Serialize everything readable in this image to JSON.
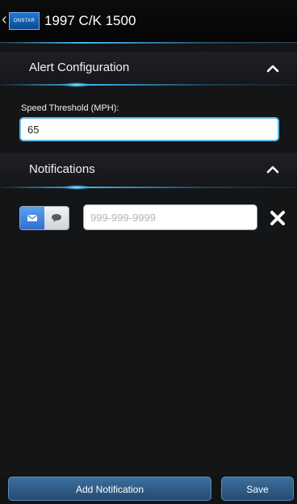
{
  "header": {
    "back_glyph": "‹",
    "logo_text": "ONSTAR",
    "title": "1997 C/K 1500"
  },
  "alert_config": {
    "title": "Alert Configuration",
    "speed_label": "Speed Threshold (MPH):",
    "speed_value": "65"
  },
  "notifications": {
    "title": "Notifications",
    "items": [
      {
        "mode_selected": "email",
        "phone_placeholder": "999-999-9999",
        "phone_value": ""
      }
    ]
  },
  "footer": {
    "add_label": "Add Notification",
    "save_label": "Save"
  },
  "colors": {
    "accent_glow": "#46beff",
    "button_blue": "#2f5f8e",
    "toggle_active": "#3a82df"
  },
  "icons": {
    "back": "chevron-left-icon",
    "section_toggle": "chevron-up-icon",
    "email": "envelope-icon",
    "sms": "chat-bubble-icon",
    "remove": "close-icon"
  }
}
